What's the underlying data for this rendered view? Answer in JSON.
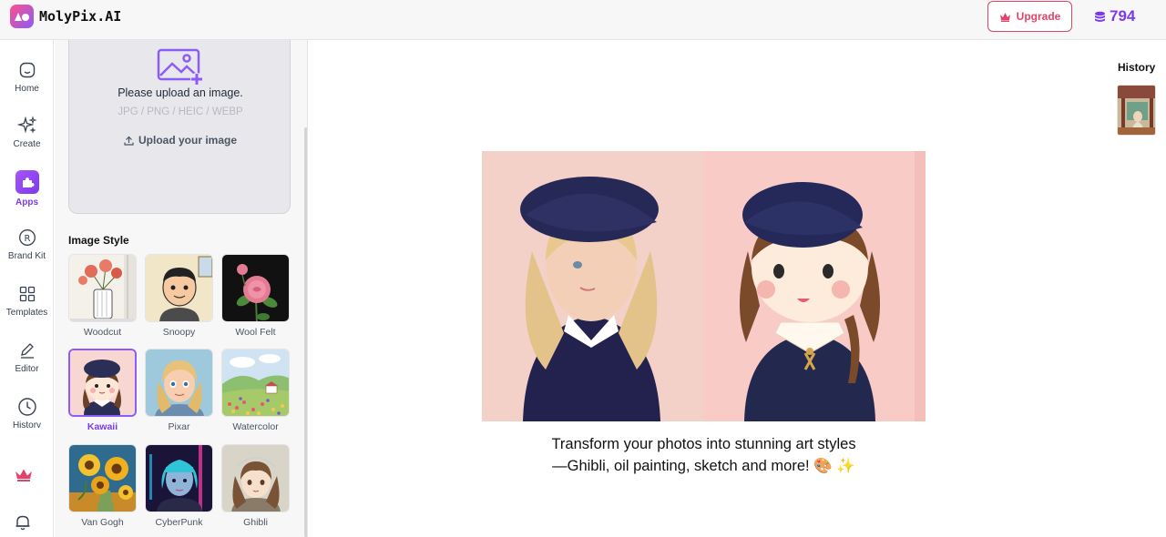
{
  "header": {
    "brand": "MolyPix.AI",
    "upgrade_label": "Upgrade",
    "credits": "794"
  },
  "nav": {
    "items": [
      {
        "label": "Home",
        "icon": "home-icon"
      },
      {
        "label": "Create",
        "icon": "sparkles-icon"
      },
      {
        "label": "Apps",
        "icon": "apps-icon",
        "active": true
      },
      {
        "label": "Brand Kit",
        "icon": "registered-icon"
      },
      {
        "label": "Templates",
        "icon": "grid-icon"
      },
      {
        "label": "Editor",
        "icon": "pencil-icon"
      },
      {
        "label": "History",
        "icon": "clock-icon"
      }
    ]
  },
  "upload": {
    "prompt": "Please upload an image.",
    "formats": "JPG / PNG / HEIC / WEBP",
    "button_label": "Upload your image"
  },
  "styles": {
    "title": "Image Style",
    "items": [
      {
        "label": "Woodcut"
      },
      {
        "label": "Snoopy"
      },
      {
        "label": "Wool Felt"
      },
      {
        "label": "Kawaii",
        "selected": true
      },
      {
        "label": "Pixar"
      },
      {
        "label": "Watercolor"
      },
      {
        "label": "Van Gogh"
      },
      {
        "label": "CyberPunk"
      },
      {
        "label": "Ghibli"
      }
    ]
  },
  "main": {
    "caption": "Transform your photos into stunning art styles—Ghibli, oil painting, sketch and more! 🎨 ✨",
    "history_title": "History"
  },
  "colors": {
    "accent": "#7c3aed",
    "upgrade": "#e0446a"
  }
}
